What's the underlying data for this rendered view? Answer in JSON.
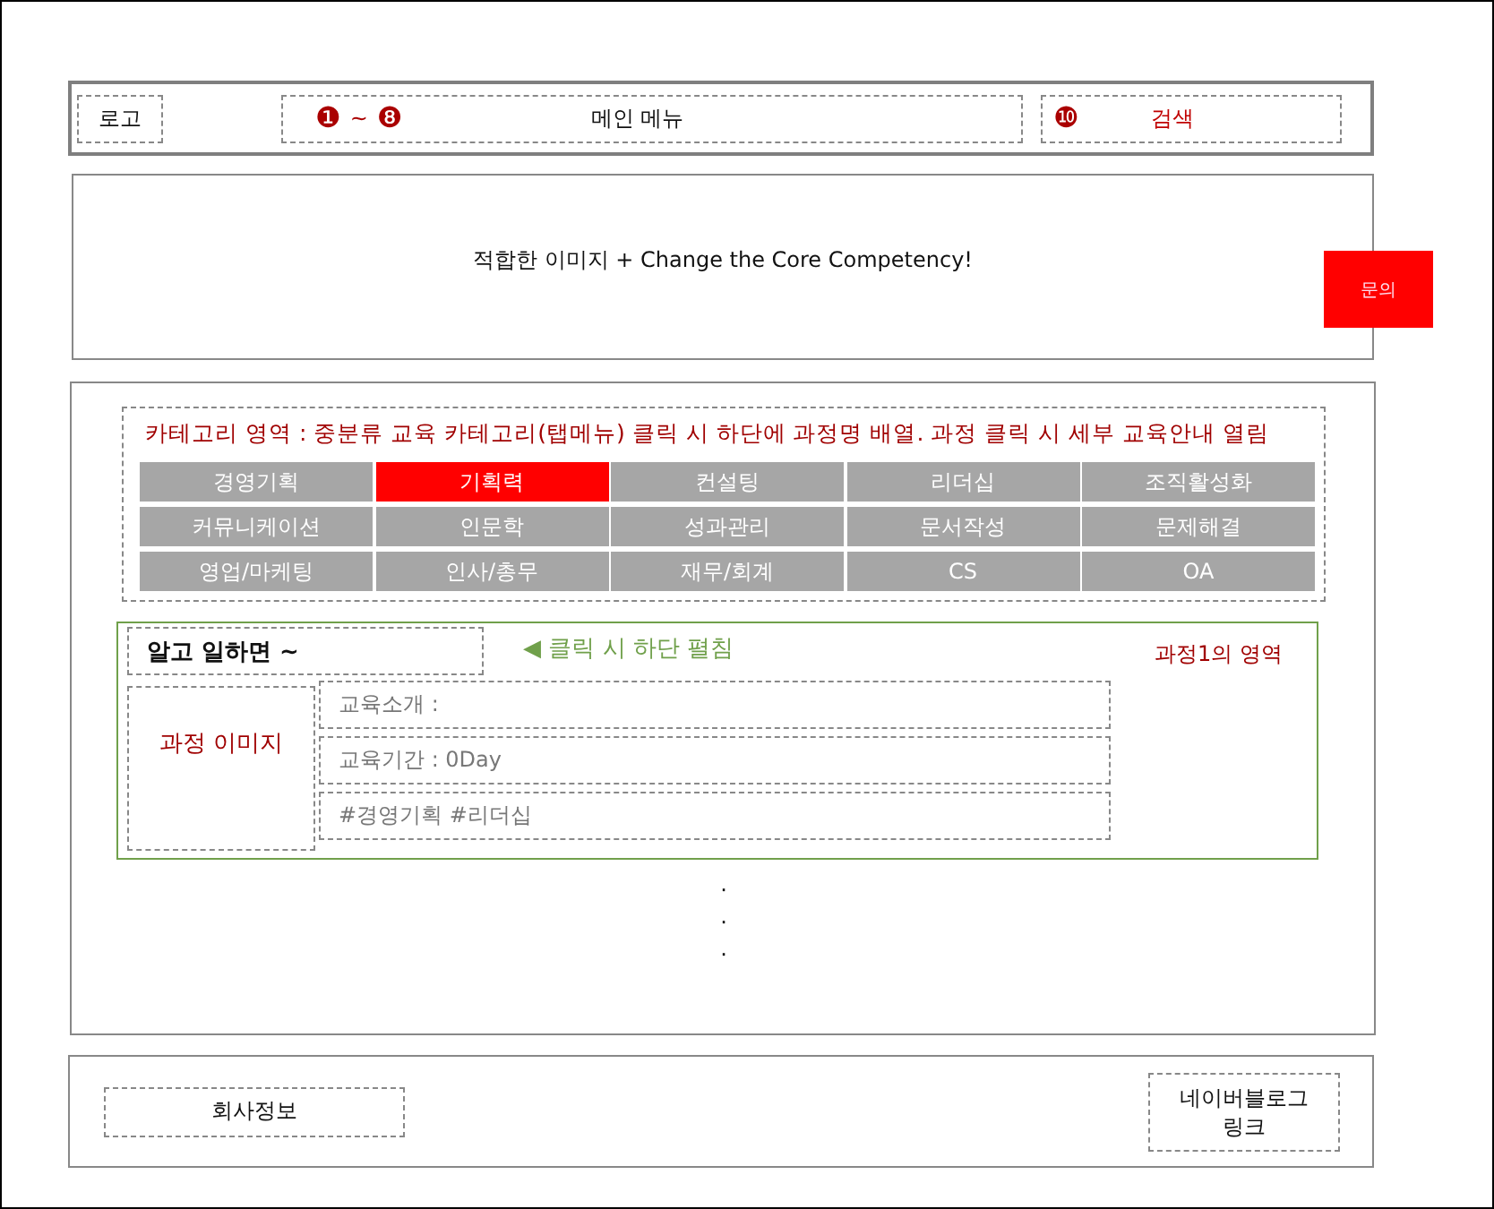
{
  "header": {
    "logo": "로고",
    "menu": {
      "start_mark": "❶",
      "range_sep": "~",
      "end_mark": "❽",
      "label": "메인 메뉴"
    },
    "search": {
      "mark": "❿",
      "label": "검색"
    }
  },
  "banner": {
    "text": "적합한 이미지 + Change the Core Competency!",
    "inquiry_button": "문의"
  },
  "categories": {
    "note": "카테고리 영역 : 중분류 교육 카테고리(탭메뉴) 클릭 시 하단에 과정명 배열. 과정 클릭 시 세부 교육안내 열림",
    "tabs": [
      {
        "label": "경영기획",
        "selected": false
      },
      {
        "label": "기획력",
        "selected": true
      },
      {
        "label": "컨설팅",
        "selected": false
      },
      {
        "label": "리더십",
        "selected": false
      },
      {
        "label": "조직활성화",
        "selected": false
      },
      {
        "label": "커뮤니케이션",
        "selected": false
      },
      {
        "label": "인문학",
        "selected": false
      },
      {
        "label": "성과관리",
        "selected": false
      },
      {
        "label": "문서작성",
        "selected": false
      },
      {
        "label": "문제해결",
        "selected": false
      },
      {
        "label": "영업/마케팅",
        "selected": false
      },
      {
        "label": "인사/총무",
        "selected": false
      },
      {
        "label": "재무/회계",
        "selected": false
      },
      {
        "label": "CS",
        "selected": false
      },
      {
        "label": "OA",
        "selected": false
      }
    ]
  },
  "course": {
    "title": "알고 일하면 ~",
    "hint_arrow": "◀",
    "hint": "클릭 시 하단 펼침",
    "area_label": "과정1의 영역",
    "image_label": "과정 이미지",
    "details": [
      "교육소개 :",
      "교육기간 : 0Day",
      "#경영기획 #리더십"
    ]
  },
  "more": [
    "·",
    "·",
    "·"
  ],
  "footer": {
    "company_info": "회사정보",
    "blog_link": "네이버블로그 링크"
  }
}
